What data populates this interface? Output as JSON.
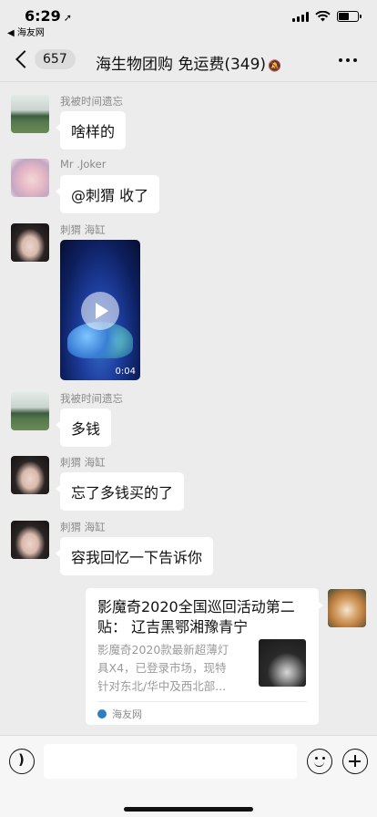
{
  "status_bar": {
    "time": "6:29",
    "location_glyph": "➚",
    "back_app": "◀ 海友网"
  },
  "nav": {
    "unread_count": "657",
    "title": "海生物团购 免运费(349)",
    "mute_icon": "bell-slash-icon"
  },
  "messages": [
    {
      "sender": "我被时间遗忘",
      "text": "啥样的",
      "avatar": "landscape"
    },
    {
      "sender": "Mr .Joker",
      "text": "@刺猬 收了",
      "avatar": "anime"
    },
    {
      "sender": "刺猬 海缸",
      "type": "video",
      "duration": "0:04",
      "avatar": "girl"
    },
    {
      "sender": "我被时间遗忘",
      "text": "多钱",
      "avatar": "landscape"
    },
    {
      "sender": "刺猬 海缸",
      "text": "忘了多钱买的了",
      "avatar": "girl"
    },
    {
      "sender": "刺猬 海缸",
      "text": "容我回忆一下告诉你",
      "avatar": "girl"
    }
  ],
  "link_card": {
    "title": "影魔奇2020全国巡回活动第二贴： 辽吉黑鄂湘豫青宁",
    "description": "影魔奇2020款最新超薄灯\n具X4，已登录市场，现特\n针对东北/华中及西北部...",
    "source": "海友网"
  },
  "colors": {
    "background": "#ececec",
    "bubble": "#ffffff",
    "sender_text": "#8a8a8a"
  }
}
